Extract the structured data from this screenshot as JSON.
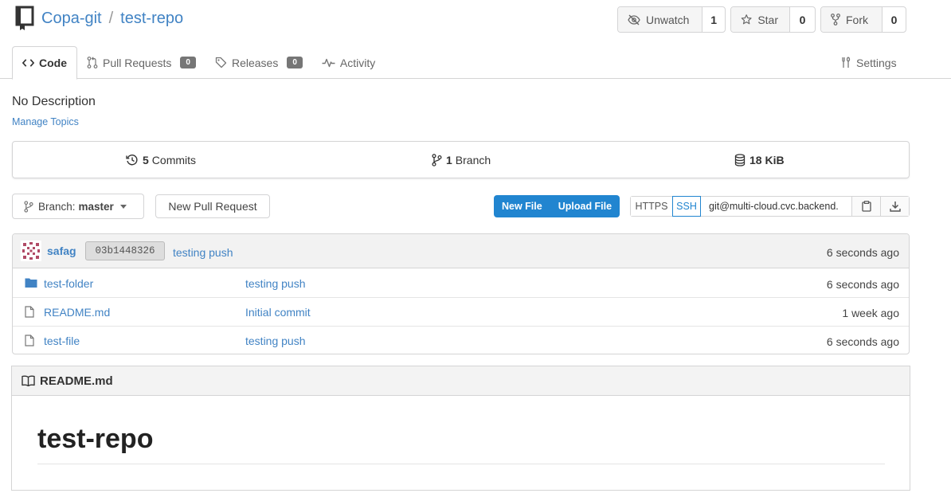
{
  "repo": {
    "owner": "Copa-git",
    "separator": "/",
    "name": "test-repo"
  },
  "actions": {
    "watch": {
      "label": "Unwatch",
      "count": "1"
    },
    "star": {
      "label": "Star",
      "count": "0"
    },
    "fork": {
      "label": "Fork",
      "count": "0"
    }
  },
  "tabs": [
    {
      "label": "Code",
      "active": true
    },
    {
      "label": "Pull Requests",
      "badge": "0"
    },
    {
      "label": "Releases",
      "badge": "0"
    },
    {
      "label": "Activity"
    }
  ],
  "settings_label": "Settings",
  "description": "No Description",
  "manage_topics": "Manage Topics",
  "stats": {
    "commits_count": "5",
    "commits_label": "Commits",
    "branch_count": "1",
    "branch_label": "Branch",
    "size": "18 KiB"
  },
  "toolbar": {
    "branch_prefix": "Branch:",
    "branch_name": "master",
    "new_pull_request": "New Pull Request",
    "new_file": "New File",
    "upload_file": "Upload File",
    "clone_https": "HTTPS",
    "clone_ssh": "SSH",
    "clone_url": "git@multi-cloud.cvc.backend."
  },
  "latest_commit": {
    "author": "safag",
    "sha": "03b1448326",
    "message": "testing push",
    "age": "6 seconds ago"
  },
  "files": [
    {
      "type": "folder",
      "name": "test-folder",
      "message": "testing push",
      "age": "6 seconds ago"
    },
    {
      "type": "file",
      "name": "README.md",
      "message": "Initial commit",
      "age": "1 week ago"
    },
    {
      "type": "file",
      "name": "test-file",
      "message": "testing push",
      "age": "6 seconds ago"
    }
  ],
  "readme": {
    "filename": "README.md",
    "heading": "test-repo"
  },
  "colors": {
    "link": "#4183c4",
    "primary": "#2185d0",
    "badge": "#767676",
    "border": "#d4d4d5"
  }
}
